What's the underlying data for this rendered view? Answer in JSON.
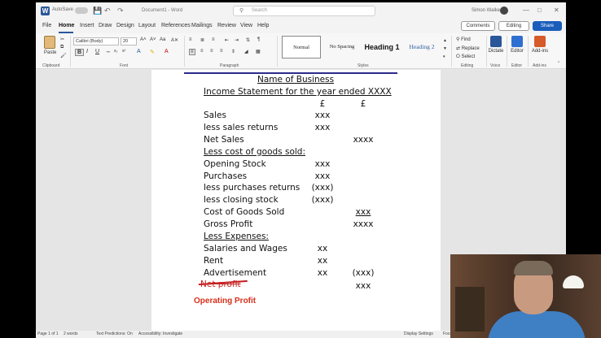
{
  "titlebar": {
    "autosave_label": "AutoSave",
    "doc_name": "Document1 - Word",
    "search_placeholder": "Search",
    "user_name": "Simon Walker"
  },
  "menu": {
    "tabs": [
      "File",
      "Home",
      "Insert",
      "Draw",
      "Design",
      "Layout",
      "References",
      "Mailings",
      "Review",
      "View",
      "Help"
    ],
    "active": "Home",
    "comments_label": "Comments",
    "editing_label": "Editing",
    "share_label": "Share"
  },
  "ribbon": {
    "clipboard_label": "Clipboard",
    "paste_label": "Paste",
    "font_name": "Calibri (Body)",
    "font_size": "20",
    "font_label": "Font",
    "paragraph_label": "Paragraph",
    "styles_label": "Styles",
    "styles": [
      "Normal",
      "No Spacing",
      "Heading 1",
      "Heading 2"
    ],
    "find_label": "Find",
    "replace_label": "Replace",
    "select_label": "Select",
    "editing_label": "Editing",
    "dictate_label": "Dictate",
    "voice_label": "Voice",
    "editor_label": "Editor",
    "editor_group_label": "Editor",
    "addins_label": "Add-ins",
    "addins_group_label": "Add-ins"
  },
  "document": {
    "title": "Name of Business",
    "subtitle": "Income Statement for the year ended XXXX",
    "currency_col1": "£",
    "currency_col2": "£",
    "rows": [
      {
        "label": "Sales",
        "c1": "xxx",
        "c2": "",
        "underline_label": false
      },
      {
        "label": "less sales returns",
        "c1": "xxx",
        "c2": "",
        "underline_label": false
      },
      {
        "label": "Net Sales",
        "c1": "",
        "c2": "xxxx",
        "underline_label": false
      },
      {
        "label": "Less cost of goods sold:",
        "c1": "",
        "c2": "",
        "underline_label": true
      },
      {
        "label": "Opening Stock",
        "c1": "xxx",
        "c2": "",
        "underline_label": false
      },
      {
        "label": "Purchases",
        "c1": "xxx",
        "c2": "",
        "underline_label": false
      },
      {
        "label": "less purchases returns",
        "c1": "(xxx)",
        "c2": "",
        "underline_label": false
      },
      {
        "label": "less closing stock",
        "c1": "(xxx)",
        "c2": "",
        "underline_label": false
      },
      {
        "label": "Cost of Goods Sold",
        "c1": "",
        "c2": "xxx",
        "underline_label": false
      },
      {
        "label": "Gross Profit",
        "c1": "",
        "c2": "xxxx",
        "underline_label": false
      },
      {
        "label": "Less Expenses:",
        "c1": "",
        "c2": "",
        "underline_label": true
      },
      {
        "label": "Salaries and Wages",
        "c1": "xx",
        "c2": "",
        "underline_label": false
      },
      {
        "label": "Rent",
        "c1": "xx",
        "c2": "",
        "underline_label": false
      },
      {
        "label": "Advertisement",
        "c1": "xx",
        "c2": "(xxx)",
        "underline_label": false
      }
    ],
    "net_profit_struck": "Net profit",
    "net_profit_value": "xxx",
    "operating_profit": "Operating Profit"
  },
  "statusbar": {
    "page": "Page 1 of 1",
    "words": "2 words",
    "text_predictions": "Text Predictions: On",
    "accessibility": "Accessibility: Investigate",
    "display_settings": "Display Settings",
    "focus": "Focus"
  }
}
